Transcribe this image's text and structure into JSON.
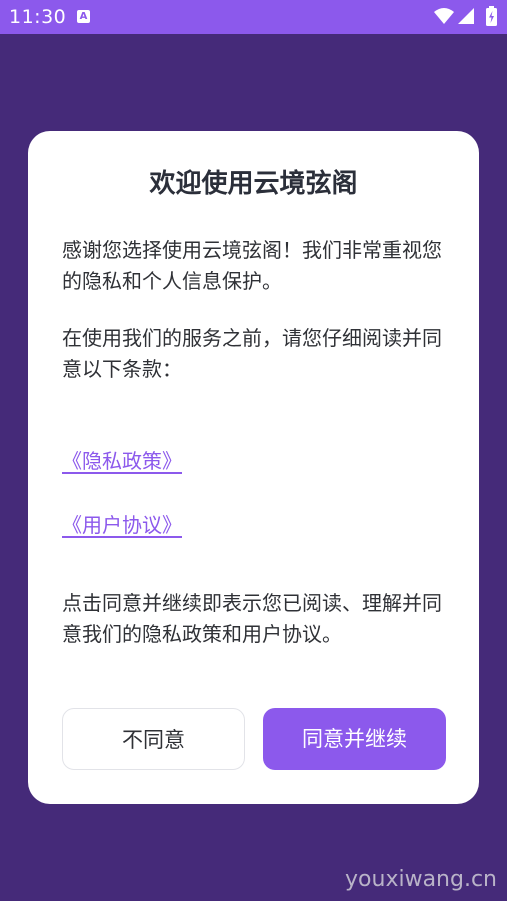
{
  "status_bar": {
    "time": "11:30",
    "notification_icon_letter": "A",
    "icons": [
      "wifi-icon",
      "signal-icon",
      "battery-charging-icon"
    ]
  },
  "dialog": {
    "title": "欢迎使用云境弦阁",
    "paragraph_intro": "感谢您选择使用云境弦阁！我们非常重视您的隐私和个人信息保护。",
    "paragraph_read": "在使用我们的服务之前，请您仔细阅读并同意以下条款：",
    "link_privacy": "《隐私政策》",
    "link_terms": "《用户协议》",
    "paragraph_consent": "点击同意并继续即表示您已阅读、理解并同意我们的隐私政策和用户协议。",
    "decline_label": "不同意",
    "accept_label": "同意并继续"
  },
  "watermark": "youxiwang.cn",
  "colors": {
    "accent": "#8c59ec",
    "background": "#452a79",
    "dialog": "#ffffff",
    "text": "#2f3136"
  }
}
